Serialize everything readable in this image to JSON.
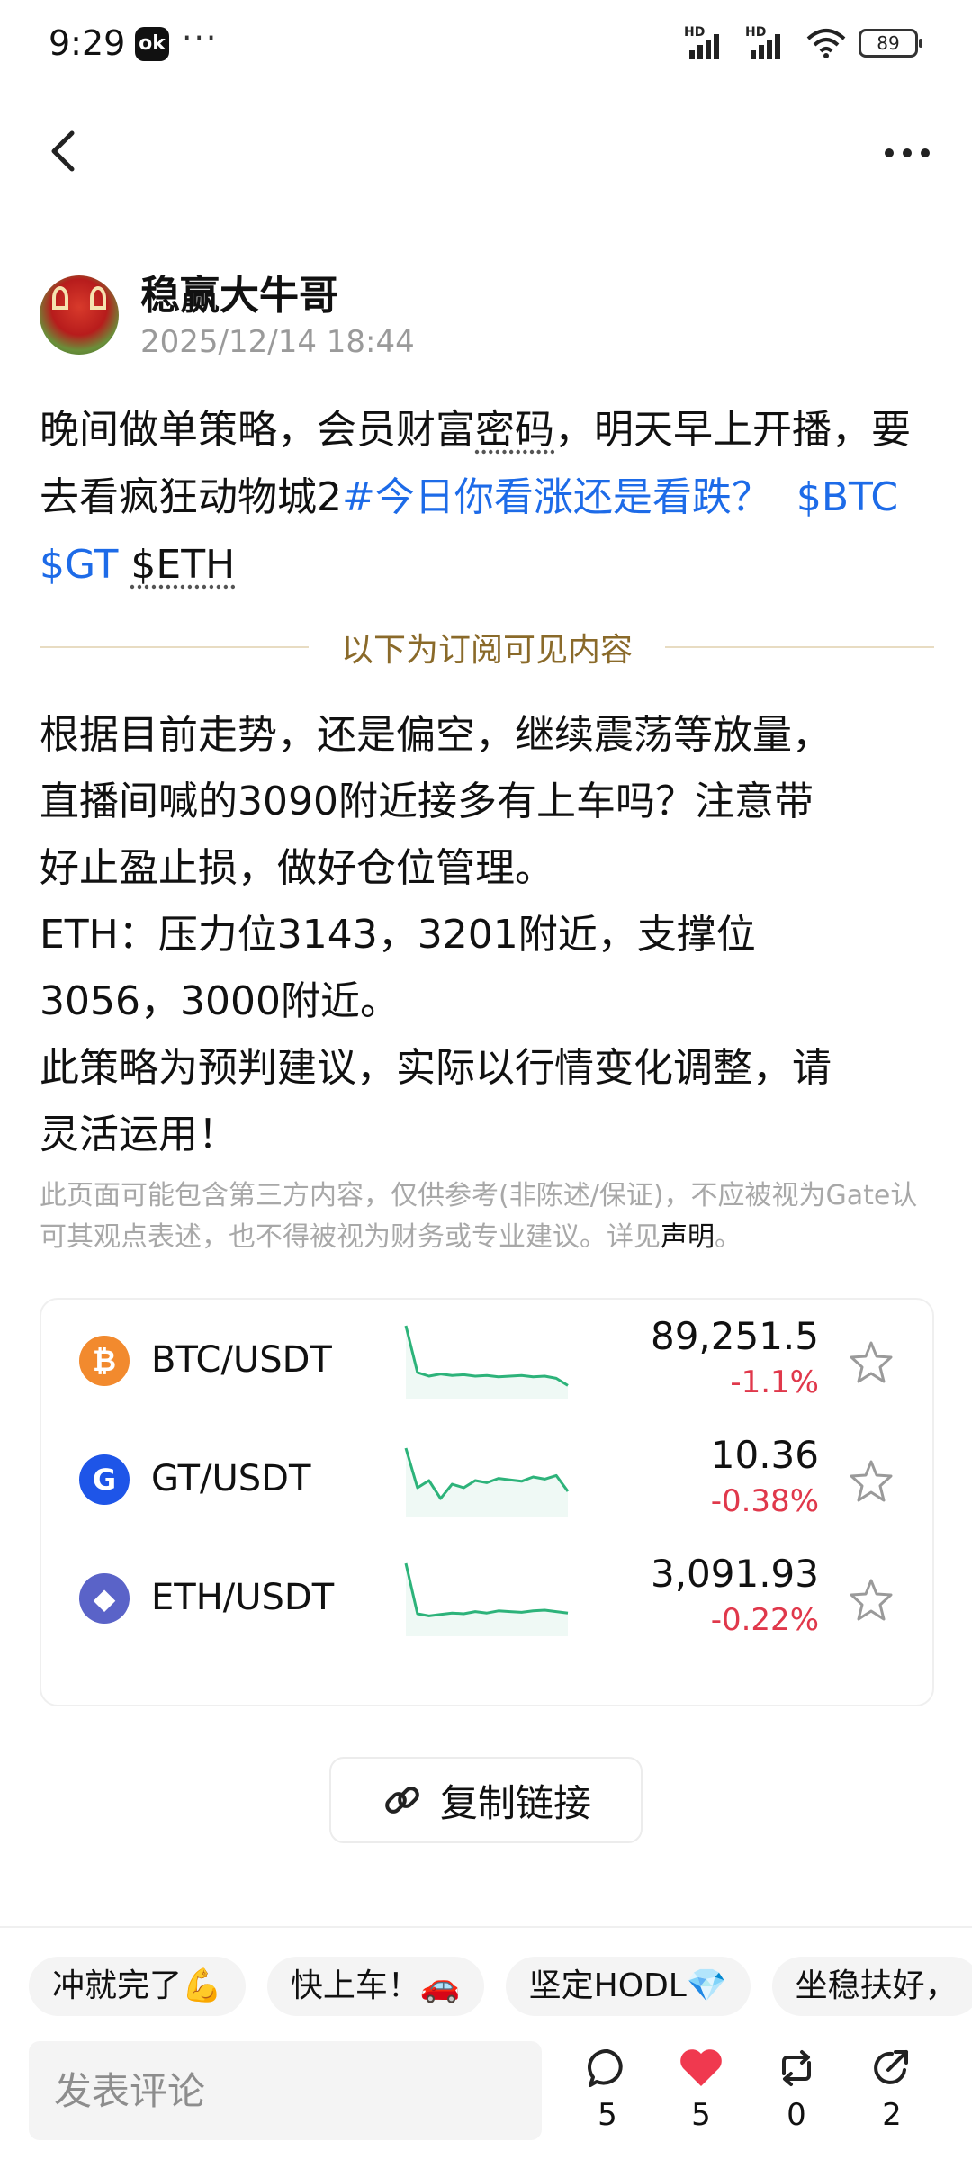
{
  "status_bar": {
    "time": "9:29",
    "app_badge": "ok",
    "dots": "···",
    "battery": "89"
  },
  "author": {
    "name": "稳赢大牛哥",
    "time": "2025/12/14 18:44"
  },
  "post": {
    "line1": "晚间做单策略，会员财富",
    "underlined1": "密码",
    "line1b": "，明天早上开播，要去看疯狂动物城2",
    "hashtag": "#今日你看涨还是看跌？",
    "tag_btc": "$BTC",
    "tag_gt": "$GT",
    "tag_eth": "$ETH",
    "divider_label": "以下为订阅可见内容",
    "body_lines": [
      "根据目前走势，还是偏空，继续震荡等放量，",
      "直播间喊的3090附近接多有上车吗？注意带",
      "好止盈止损，做好仓位管理。",
      "ETH：压力位3143，3201附近，支撑位",
      "3056，3000附近。",
      "此策略为预判建议，实际以行情变化调整，请",
      "灵活运用！"
    ],
    "disclaimer": "此页面可能包含第三方内容，仅供参考(非陈述/保证)，不应被视为Gate认可其观点表述，也不得被视为财务或专业建议。详见",
    "disclaimer_link": "声明",
    "disclaimer_end": "。"
  },
  "market": [
    {
      "pair": "BTC/USDT",
      "price": "89,251.5",
      "change": "-1.1%",
      "icon": "btc-icon",
      "spark": [
        95,
        30,
        25,
        28,
        26,
        27,
        25,
        26,
        24,
        25,
        26,
        24,
        25,
        22,
        12
      ]
    },
    {
      "pair": "GT/USDT",
      "price": "10.36",
      "change": "-0.38%",
      "icon": "gt-icon",
      "spark": [
        90,
        35,
        45,
        20,
        40,
        35,
        45,
        42,
        48,
        46,
        44,
        50,
        47,
        52,
        30
      ]
    },
    {
      "pair": "ETH/USDT",
      "price": "3,091.93",
      "change": "-0.22%",
      "icon": "eth-icon",
      "spark": [
        95,
        25,
        22,
        24,
        26,
        25,
        28,
        26,
        29,
        28,
        27,
        29,
        30,
        28,
        26
      ]
    }
  ],
  "copy_link": "复制链接",
  "quick_replies": [
    "冲就完了💪",
    "快上车！🚗",
    "坚定HODL💎",
    "坐稳扶好，"
  ],
  "comment": {
    "placeholder": "发表评论"
  },
  "actions": {
    "comments": "5",
    "likes": "5",
    "reposts": "0",
    "shares": "2"
  },
  "colors": {
    "link": "#1d6be8",
    "down": "#e0384b",
    "spark": "#2db37a",
    "like": "#f0394f"
  }
}
